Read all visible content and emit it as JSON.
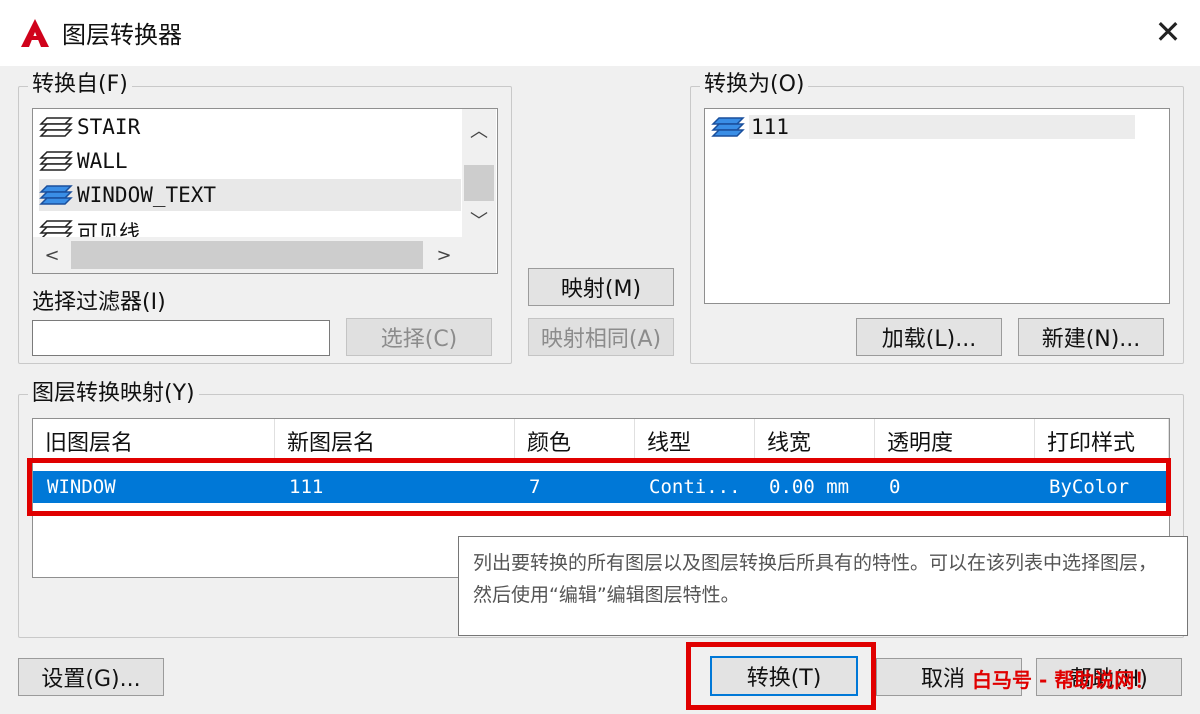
{
  "window": {
    "title": "图层转换器",
    "close_symbol": "✕"
  },
  "convert_from": {
    "legend": "转换自(F)",
    "layers": [
      {
        "name": "STAIR",
        "icon": "layer-stack-icon",
        "selected": false
      },
      {
        "name": "WALL",
        "icon": "layer-stack-icon",
        "selected": false
      },
      {
        "name": "WINDOW_TEXT",
        "icon": "layer-stack-blue-icon",
        "selected": true
      },
      {
        "name": "可见线",
        "icon": "layer-stack-icon",
        "selected": false
      }
    ],
    "filter_label": "选择过滤器(I)",
    "filter_value": "",
    "select_button": "选择(C)"
  },
  "map_buttons": {
    "map": "映射(M)",
    "map_same": "映射相同(A)"
  },
  "convert_to": {
    "legend": "转换为(O)",
    "layers": [
      {
        "name": "111",
        "icon": "layer-stack-blue-icon"
      }
    ],
    "load_button": "加载(L)...",
    "new_button": "新建(N)..."
  },
  "mapping": {
    "legend": "图层转换映射(Y)",
    "columns": [
      "旧图层名",
      "新图层名",
      "颜色",
      "线型",
      "线宽",
      "透明度",
      "打印样式"
    ],
    "rows": [
      {
        "old": "WINDOW",
        "new": "111",
        "color": "7",
        "linetype": "Conti...",
        "lineweight": "0.00 mm",
        "transparency": "0",
        "plot_style": "ByColor"
      }
    ]
  },
  "tooltip": "列出要转换的所有图层以及图层转换后所具有的特性。可以在该列表中选择图层，然后使用“编辑”编辑图层特性。",
  "footer": {
    "settings_button": "设置(G)...",
    "convert_button": "转换(T)",
    "cancel_button": "取消",
    "help_button": "帮助(H)"
  },
  "watermark": "白马号 - 帮助说网！",
  "colors": {
    "accent_blue": "#0078d7",
    "highlight_red": "#e00000",
    "logo_red": "#d0021b"
  }
}
